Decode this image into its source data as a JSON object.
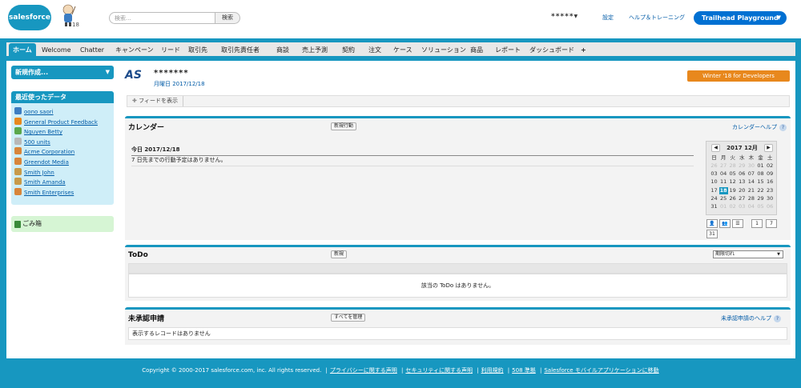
{
  "header": {
    "logo_text": "salesforce",
    "mascot_badge": "18",
    "search_placeholder": "検索...",
    "search_button": "検索",
    "user_name": "*****",
    "setup_label": "設定",
    "help_label": "ヘルプ＆トレーニング",
    "app_switcher_label": "Trailhead Playground"
  },
  "tabs": [
    "ホーム",
    "Welcome",
    "Chatter",
    "キャンペーン",
    "リード",
    "取引先",
    "取引先責任者",
    "商談",
    "売上予測",
    "契約",
    "注文",
    "ケース",
    "ソリューション",
    "商品",
    "レポート",
    "ダッシュボード",
    "+"
  ],
  "sidebar": {
    "new_create_label": "新規作成...",
    "recent_title": "最近使ったデータ",
    "recent_items": [
      {
        "label": "oono saori",
        "icon": "user-icon",
        "color": "#3c7dc2"
      },
      {
        "label": "General Product Feedback",
        "icon": "group-icon",
        "color": "#e8881d"
      },
      {
        "label": "Nguyen Betty",
        "icon": "lead-icon",
        "color": "#5aa84c"
      },
      {
        "label": "500 units",
        "icon": "opportunity-icon",
        "color": "#b8b8b8"
      },
      {
        "label": "Acme Corporation",
        "icon": "account-icon",
        "color": "#d8853a"
      },
      {
        "label": "Greendot Media",
        "icon": "account-icon",
        "color": "#d8853a"
      },
      {
        "label": "Smith John",
        "icon": "contact-icon",
        "color": "#c89a4a"
      },
      {
        "label": "Smith Amanda",
        "icon": "contact-icon",
        "color": "#c89a4a"
      },
      {
        "label": "Smith Enterprises",
        "icon": "account-icon",
        "color": "#d8853a"
      }
    ],
    "trash_label": "ごみ箱"
  },
  "main": {
    "company_logo": "AS",
    "company_name": "*******",
    "date_line": "月曜日 2017/12/18",
    "winter_button": "Winter '18 for Developers",
    "feed_link": "フィードを表示"
  },
  "calendar": {
    "title": "カレンダー",
    "new_button": "新規行動",
    "help_label": "カレンダーヘルプ",
    "today_line": "今日 2017/12/18",
    "empty_message": "7 日先までの行動予定はありません。",
    "mini_month": "2017 12月",
    "weekday_headers": [
      "日",
      "月",
      "火",
      "水",
      "木",
      "金",
      "土"
    ],
    "weeks": [
      [
        "26",
        "27",
        "28",
        "29",
        "30",
        "01",
        "02"
      ],
      [
        "03",
        "04",
        "05",
        "06",
        "07",
        "08",
        "09"
      ],
      [
        "10",
        "11",
        "12",
        "13",
        "14",
        "15",
        "16"
      ],
      [
        "17",
        "18",
        "19",
        "20",
        "21",
        "22",
        "23"
      ],
      [
        "24",
        "25",
        "26",
        "27",
        "28",
        "29",
        "30"
      ],
      [
        "31",
        "01",
        "02",
        "03",
        "04",
        "05",
        "06"
      ]
    ],
    "today_day": "18",
    "view_day": "1",
    "view_week": "7",
    "view_month": "31"
  },
  "todo": {
    "title": "ToDo",
    "new_button": "新規",
    "filter_value": "期限切れ",
    "empty_message": "該当の ToDo はありません。"
  },
  "approval": {
    "title": "未承認申請",
    "manage_button": "すべてを管理",
    "help_label": "未承認申請のヘルプ",
    "empty_message": "表示するレコードはありません"
  },
  "footer": {
    "copyright": "Copyright © 2000-2017 salesforce.com, inc. All rights reserved.",
    "links": [
      "プライバシーに関する声明",
      "セキュリティに関する声明",
      "利用規約",
      "508 準拠",
      "Salesforce モバイルアプリケーションに移動"
    ]
  },
  "colors": {
    "accent": "#1797c0",
    "brand_blue": "#0070d2",
    "winter_orange": "#e8881d"
  }
}
